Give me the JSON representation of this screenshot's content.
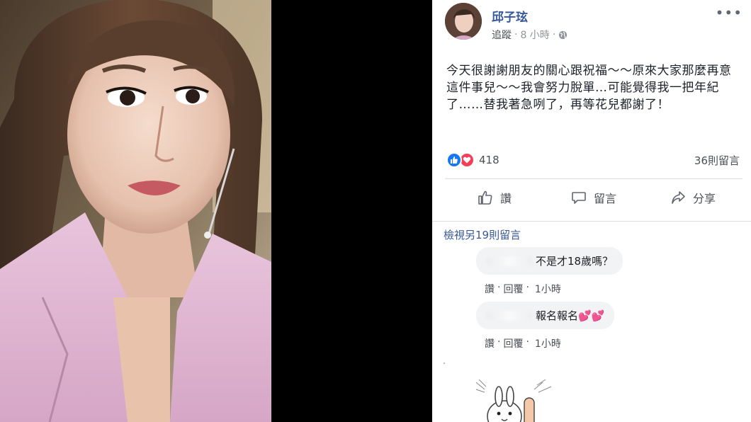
{
  "post": {
    "author": "邱子玹",
    "follow_label": "追蹤",
    "dot": "·",
    "time": "8 小時",
    "more": "•••",
    "text": "今天很謝謝朋友的關心跟祝福～～原來大家那麼再意這件事兒～～我會努力脫單…可能覺得我一把年紀了……替我著急咧了，再等花兒都謝了！",
    "reaction_count": "418",
    "comment_count": "36則留言",
    "reaction_icons": [
      "like-icon",
      "love-icon"
    ]
  },
  "actions": {
    "like_label": "讚",
    "comment_label": "留言",
    "share_label": "分享"
  },
  "comments": {
    "view_more": "檢視另19則留言",
    "items": [
      {
        "text": "不是才18歲嗎？",
        "like": "讚",
        "dot": "·",
        "reply": "回覆",
        "time": "1小時"
      },
      {
        "text": "報名報名💕💕",
        "like": "讚",
        "dot": "·",
        "reply": "回覆",
        "time": "1小時"
      }
    ]
  },
  "colors": {
    "link": "#365899",
    "like_blue": "#1877f2",
    "love_red": "#f33e58",
    "bubble_bg": "#f2f3f5"
  }
}
